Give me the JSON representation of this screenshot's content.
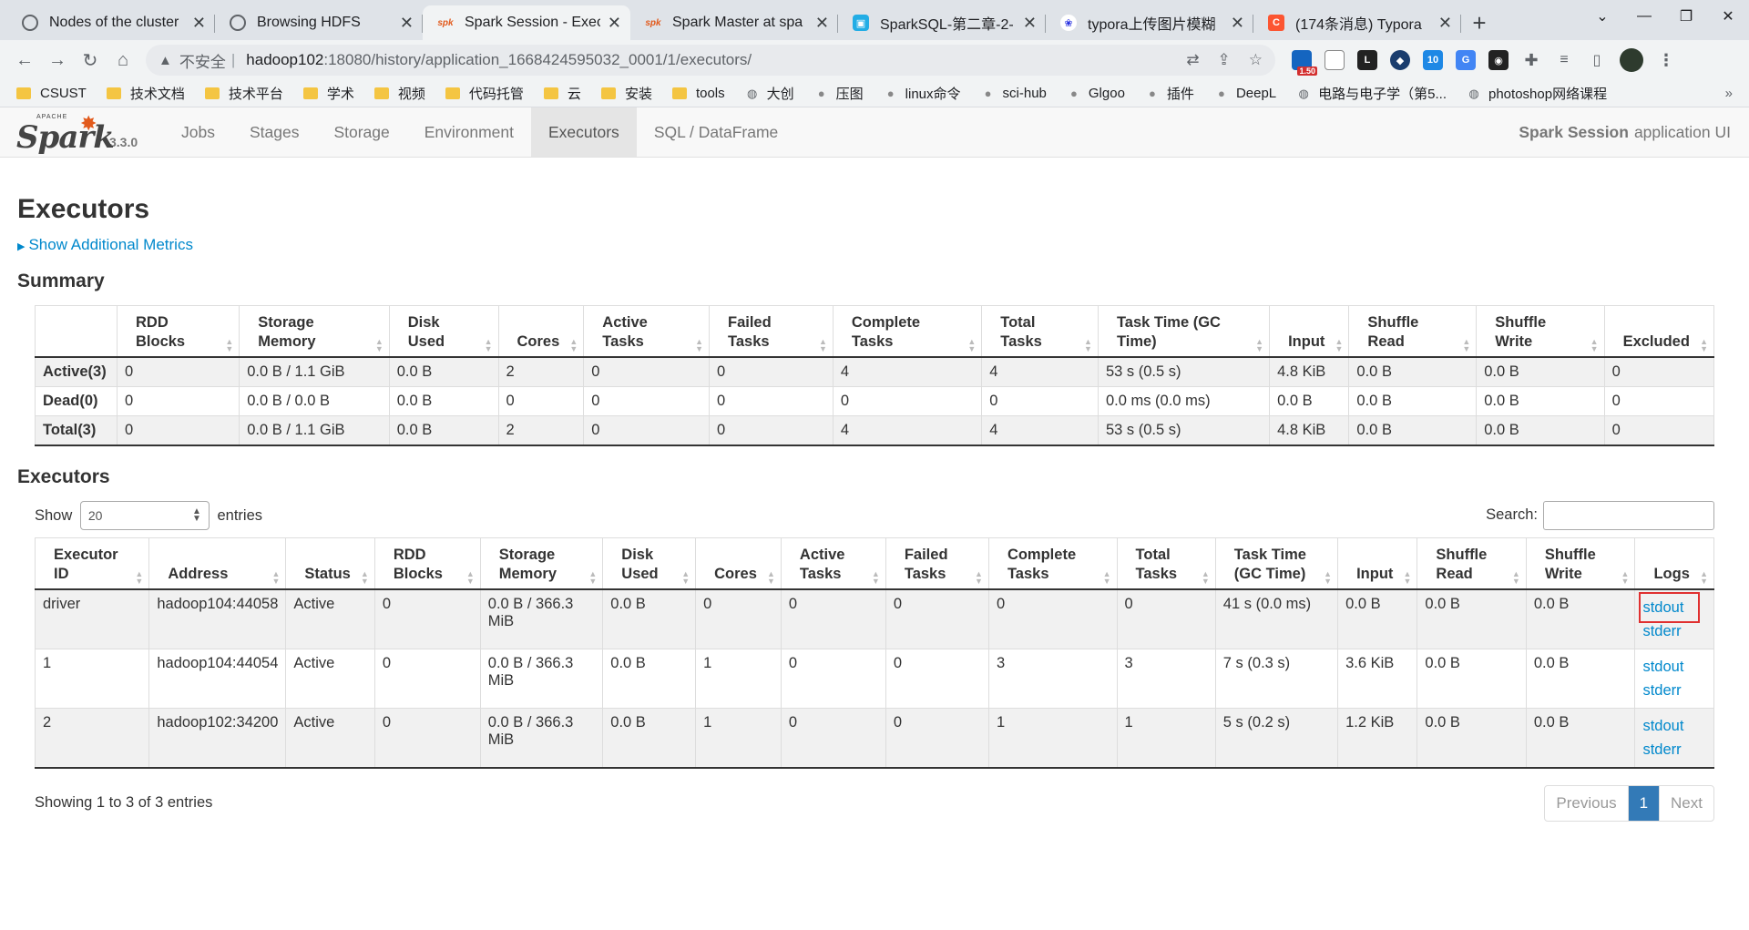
{
  "browser": {
    "tabs": [
      {
        "title": "Nodes of the cluster",
        "icon": "globe-icon",
        "active": false
      },
      {
        "title": "Browsing HDFS",
        "icon": "globe-icon",
        "active": false
      },
      {
        "title": "Spark Session - Exec",
        "icon": "spark-icon",
        "active": true
      },
      {
        "title": "Spark Master at spa",
        "icon": "spark-icon",
        "active": false
      },
      {
        "title": "SparkSQL-第二章-2-",
        "icon": "bilibili-icon",
        "active": false
      },
      {
        "title": "typora上传图片模糊",
        "icon": "baidu-icon",
        "active": false
      },
      {
        "title": "(174条消息) Typora",
        "icon": "csdn-icon",
        "active": false
      }
    ],
    "url": {
      "security_label": "不安全",
      "host": "hadoop102",
      "path": ":18080/history/application_1668424595032_0001/1/executors/"
    },
    "extension_badge": "1.50",
    "bookmarks": [
      {
        "label": "CSUST",
        "type": "folder"
      },
      {
        "label": "技术文档",
        "type": "folder"
      },
      {
        "label": "技术平台",
        "type": "folder"
      },
      {
        "label": "学术",
        "type": "folder"
      },
      {
        "label": "视频",
        "type": "folder"
      },
      {
        "label": "代码托管",
        "type": "folder"
      },
      {
        "label": "云",
        "type": "folder"
      },
      {
        "label": "安装",
        "type": "folder"
      },
      {
        "label": "tools",
        "type": "folder"
      },
      {
        "label": "大创",
        "type": "globe"
      },
      {
        "label": "压图",
        "type": "site"
      },
      {
        "label": "linux命令",
        "type": "site"
      },
      {
        "label": "sci-hub",
        "type": "site"
      },
      {
        "label": "Glgoo",
        "type": "site"
      },
      {
        "label": "插件",
        "type": "site"
      },
      {
        "label": "DeepL",
        "type": "site"
      },
      {
        "label": "电路与电子学（第5...",
        "type": "globe"
      },
      {
        "label": "photoshop网络课程",
        "type": "globe"
      }
    ]
  },
  "spark": {
    "version": "3.3.0",
    "nav": [
      "Jobs",
      "Stages",
      "Storage",
      "Environment",
      "Executors",
      "SQL / DataFrame"
    ],
    "active_nav": "Executors",
    "app_name_bold": "Spark Session",
    "app_name_suffix": "application UI"
  },
  "page": {
    "title": "Executors",
    "additional_metrics": "Show Additional Metrics",
    "summary_title": "Summary",
    "executors_title": "Executors"
  },
  "summary": {
    "headers": [
      "",
      "RDD Blocks",
      "Storage Memory",
      "Disk Used",
      "Cores",
      "Active Tasks",
      "Failed Tasks",
      "Complete Tasks",
      "Total Tasks",
      "Task Time (GC Time)",
      "Input",
      "Shuffle Read",
      "Shuffle Write",
      "Excluded"
    ],
    "rows": [
      [
        "Active(3)",
        "0",
        "0.0 B / 1.1 GiB",
        "0.0 B",
        "2",
        "0",
        "0",
        "4",
        "4",
        "53 s (0.5 s)",
        "4.8 KiB",
        "0.0 B",
        "0.0 B",
        "0"
      ],
      [
        "Dead(0)",
        "0",
        "0.0 B / 0.0 B",
        "0.0 B",
        "0",
        "0",
        "0",
        "0",
        "0",
        "0.0 ms (0.0 ms)",
        "0.0 B",
        "0.0 B",
        "0.0 B",
        "0"
      ],
      [
        "Total(3)",
        "0",
        "0.0 B / 1.1 GiB",
        "0.0 B",
        "2",
        "0",
        "0",
        "4",
        "4",
        "53 s (0.5 s)",
        "4.8 KiB",
        "0.0 B",
        "0.0 B",
        "0"
      ]
    ]
  },
  "executors": {
    "show_label": "Show",
    "page_length": "20",
    "entries_label": "entries",
    "search_label": "Search:",
    "headers": [
      "Executor ID",
      "Address",
      "Status",
      "RDD Blocks",
      "Storage Memory",
      "Disk Used",
      "Cores",
      "Active Tasks",
      "Failed Tasks",
      "Complete Tasks",
      "Total Tasks",
      "Task Time (GC Time)",
      "Input",
      "Shuffle Read",
      "Shuffle Write",
      "Logs"
    ],
    "rows": [
      [
        "driver",
        "hadoop104:44058",
        "Active",
        "0",
        "0.0 B / 366.3 MiB",
        "0.0 B",
        "0",
        "0",
        "0",
        "0",
        "0",
        "41 s (0.0 ms)",
        "0.0 B",
        "0.0 B",
        "0.0 B"
      ],
      [
        "1",
        "hadoop104:44054",
        "Active",
        "0",
        "0.0 B / 366.3 MiB",
        "0.0 B",
        "1",
        "0",
        "0",
        "3",
        "3",
        "7 s (0.3 s)",
        "3.6 KiB",
        "0.0 B",
        "0.0 B"
      ],
      [
        "2",
        "hadoop102:34200",
        "Active",
        "0",
        "0.0 B / 366.3 MiB",
        "0.0 B",
        "1",
        "0",
        "0",
        "1",
        "1",
        "5 s (0.2 s)",
        "1.2 KiB",
        "0.0 B",
        "0.0 B"
      ]
    ],
    "log_links": [
      "stdout",
      "stderr"
    ],
    "info": "Showing 1 to 3 of 3 entries",
    "pager": {
      "previous": "Previous",
      "current": "1",
      "next": "Next"
    }
  },
  "colors": {
    "link": "#0088cc",
    "spark_orange": "#e25a1c",
    "highlight_box": "#e03030",
    "pager_active": "#337ab7"
  }
}
